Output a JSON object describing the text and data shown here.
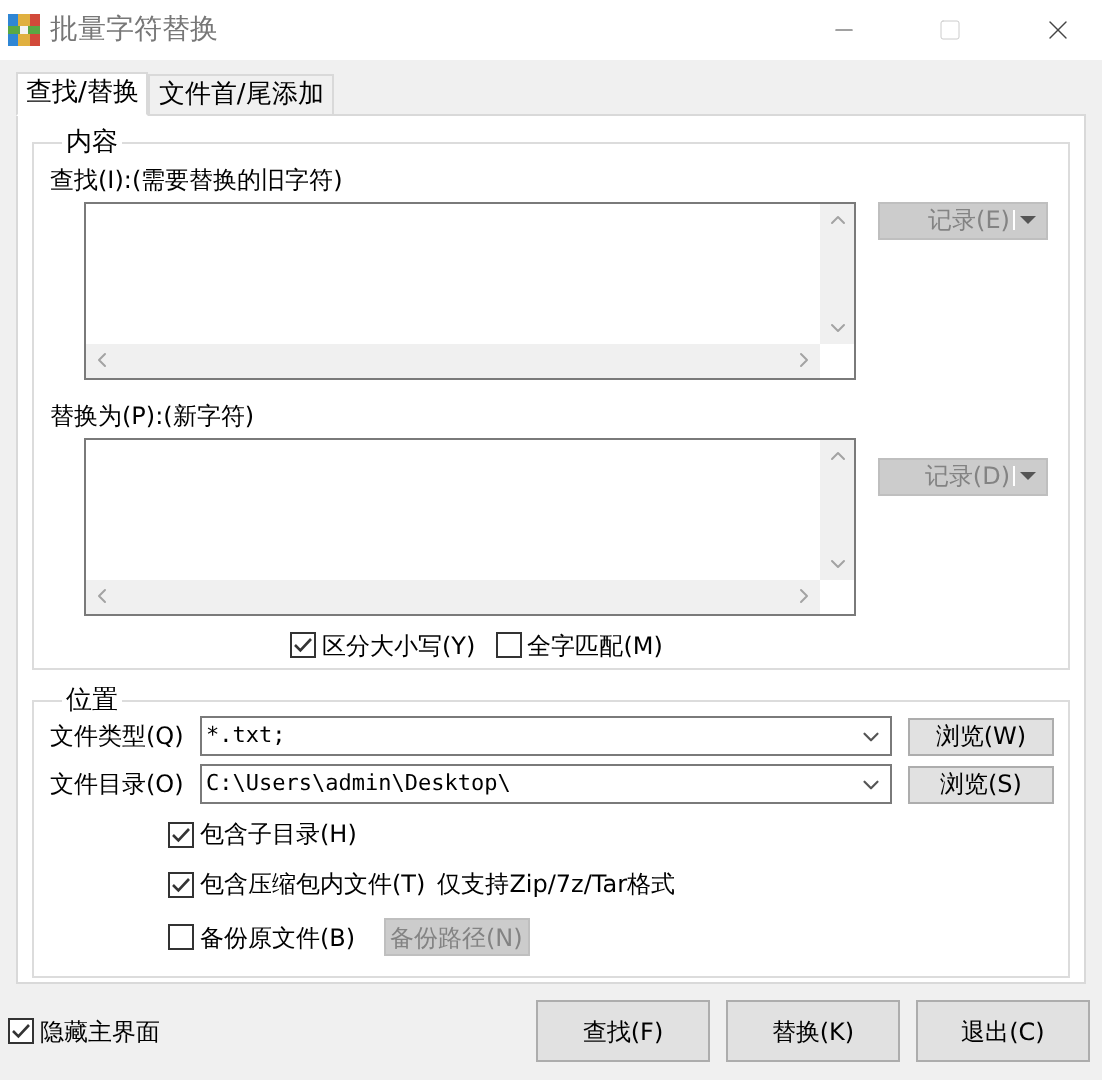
{
  "window": {
    "title": "批量字符替换"
  },
  "tabs": [
    {
      "label": "查找/替换",
      "selected": true
    },
    {
      "label": "文件首/尾添加",
      "selected": false
    }
  ],
  "content_group": {
    "title": "内容",
    "find": {
      "label": "查找(I):(需要替换的旧字符)",
      "history_button": {
        "label": "记录(E)",
        "disabled": true
      }
    },
    "replace": {
      "label": "替换为(P):(新字符)",
      "history_button": {
        "label": "记录(D)",
        "disabled": true
      }
    },
    "options": [
      {
        "label": "区分大小写(Y)",
        "checked": true
      },
      {
        "label": "全字匹配(M)",
        "checked": false
      }
    ]
  },
  "location_group": {
    "title": "位置",
    "fields": [
      {
        "label": "文件类型(Q)",
        "value": "*.txt;",
        "browse_button": "浏览(W)"
      },
      {
        "label": "文件目录(O)",
        "value": "C:\\Users\\admin\\Desktop\\",
        "browse_button": "浏览(S)"
      }
    ],
    "options": [
      {
        "label": "包含子目录(H)",
        "checked": true
      },
      {
        "label": "包含压缩包内文件(T)",
        "checked": true,
        "note": "仅支持Zip/7z/Tar格式"
      },
      {
        "label": "备份原文件(B)",
        "checked": false,
        "button": {
          "label": "备份路径(N)",
          "disabled": true
        }
      }
    ]
  },
  "hide_main": {
    "label": "隐藏主界面",
    "checked": true
  },
  "buttons": [
    "查找(F)",
    "替换(K)",
    "退出(C)"
  ]
}
